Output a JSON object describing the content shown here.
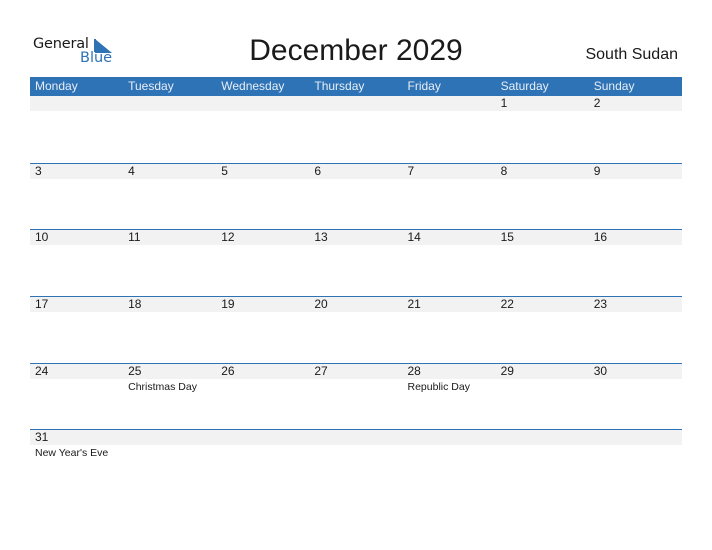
{
  "brand": {
    "word1": "General",
    "word2": "Blue",
    "accent": "#2E73B5"
  },
  "title": "December 2029",
  "country": "South Sudan",
  "weekdays": [
    "Monday",
    "Tuesday",
    "Wednesday",
    "Thursday",
    "Friday",
    "Saturday",
    "Sunday"
  ],
  "weeks": [
    [
      {
        "d": ""
      },
      {
        "d": ""
      },
      {
        "d": ""
      },
      {
        "d": ""
      },
      {
        "d": ""
      },
      {
        "d": "1"
      },
      {
        "d": "2"
      }
    ],
    [
      {
        "d": "3"
      },
      {
        "d": "4"
      },
      {
        "d": "5"
      },
      {
        "d": "6"
      },
      {
        "d": "7"
      },
      {
        "d": "8"
      },
      {
        "d": "9"
      }
    ],
    [
      {
        "d": "10"
      },
      {
        "d": "11"
      },
      {
        "d": "12"
      },
      {
        "d": "13"
      },
      {
        "d": "14"
      },
      {
        "d": "15"
      },
      {
        "d": "16"
      }
    ],
    [
      {
        "d": "17"
      },
      {
        "d": "18"
      },
      {
        "d": "19"
      },
      {
        "d": "20"
      },
      {
        "d": "21"
      },
      {
        "d": "22"
      },
      {
        "d": "23"
      }
    ],
    [
      {
        "d": "24"
      },
      {
        "d": "25",
        "h": "Christmas Day"
      },
      {
        "d": "26"
      },
      {
        "d": "27"
      },
      {
        "d": "28",
        "h": "Republic Day"
      },
      {
        "d": "29"
      },
      {
        "d": "30"
      }
    ],
    [
      {
        "d": "31",
        "h": "New Year's Eve"
      },
      {
        "d": ""
      },
      {
        "d": ""
      },
      {
        "d": ""
      },
      {
        "d": ""
      },
      {
        "d": ""
      },
      {
        "d": ""
      }
    ]
  ]
}
